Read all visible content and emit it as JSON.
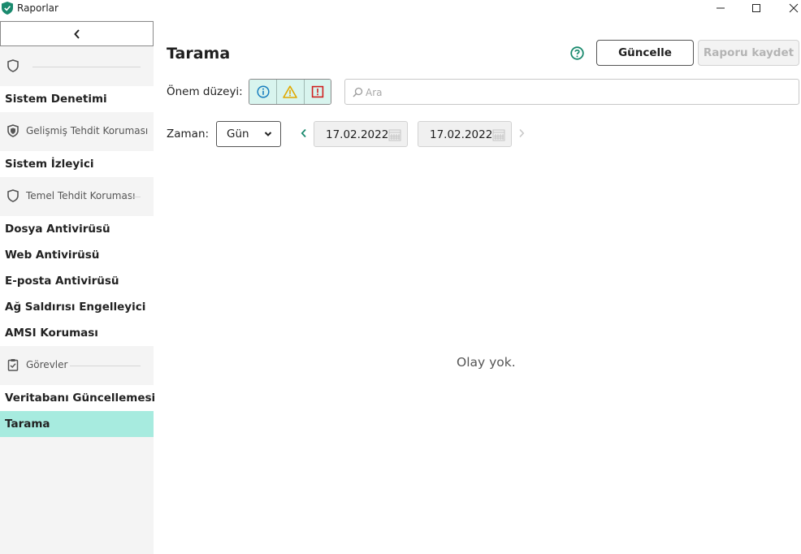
{
  "window": {
    "title": "Raporlar"
  },
  "sidebar": {
    "groups": [
      {
        "icon": "shield-icon",
        "label": ""
      },
      {
        "icon": "shield-plus-icon",
        "label": "Gelişmiş Tehdit Koruması"
      },
      {
        "icon": "shield-icon",
        "label": "Temel Tehdit Koruması"
      },
      {
        "icon": "clipboard-check-icon",
        "label": "Görevler"
      }
    ],
    "items": [
      {
        "label": "Sistem Denetimi"
      },
      {
        "label": "Sistem İzleyici"
      },
      {
        "label": "Dosya Antivirüsü"
      },
      {
        "label": "Web Antivirüsü"
      },
      {
        "label": "E-posta Antivirüsü"
      },
      {
        "label": "Ağ Saldırısı Engelleyici"
      },
      {
        "label": "AMSI Koruması"
      },
      {
        "label": "Veritabanı Güncellemesi"
      },
      {
        "label": "Tarama",
        "active": true
      }
    ]
  },
  "main": {
    "title": "Tarama",
    "update_button": "Güncelle",
    "save_button": "Raporu kaydet",
    "severity_label": "Önem düzeyi:",
    "search_placeholder": "Ara",
    "time_label": "Zaman:",
    "period_value": "Gün",
    "date_from": "17.02.2022",
    "date_to": "17.02.2022",
    "empty_message": "Olay yok."
  },
  "colors": {
    "accent": "#1a8a6e",
    "active_item": "#a7ebdf",
    "severity_bg": "#d8f4ee",
    "info": "#1a7fbf",
    "warning": "#e0a800",
    "error": "#d02020"
  }
}
